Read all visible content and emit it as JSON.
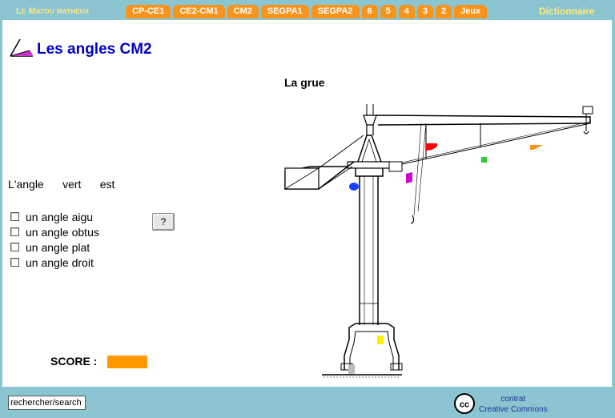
{
  "nav": {
    "brand": "Le Matou matheux",
    "tabs": [
      "CP-CE1",
      "CE2-CM1",
      "CM2",
      "SEGPA1",
      "SEGPA2",
      "6",
      "5",
      "4",
      "3",
      "2",
      "Jeux"
    ],
    "dictionary": "Dictionnaire"
  },
  "page": {
    "title": "Les angles CM2",
    "crane_title": "La grue"
  },
  "question": {
    "word1": "L'angle",
    "color_word": "vert",
    "word2": "est"
  },
  "options": [
    {
      "label": "un angle aigu",
      "checked": false
    },
    {
      "label": "un angle obtus",
      "checked": false
    },
    {
      "label": "un angle plat",
      "checked": false
    },
    {
      "label": "un angle droit",
      "checked": false
    }
  ],
  "help_button": "?",
  "score": {
    "label": "SCORE :",
    "color": "#ff9900"
  },
  "footer": {
    "search_value": "rechercher/search",
    "cc_line1": "contrat",
    "cc_line2": "Creative Commons"
  },
  "angle_markers": {
    "red": "#ff0000",
    "orange": "#ff8c1a",
    "green": "#2ecc2e",
    "magenta": "#cc00cc",
    "blue": "#1f3fff",
    "yellow": "#ffee00",
    "grey": "#bbbbbb"
  },
  "icons": [
    "angle-icon",
    "creative-commons-icon"
  ]
}
